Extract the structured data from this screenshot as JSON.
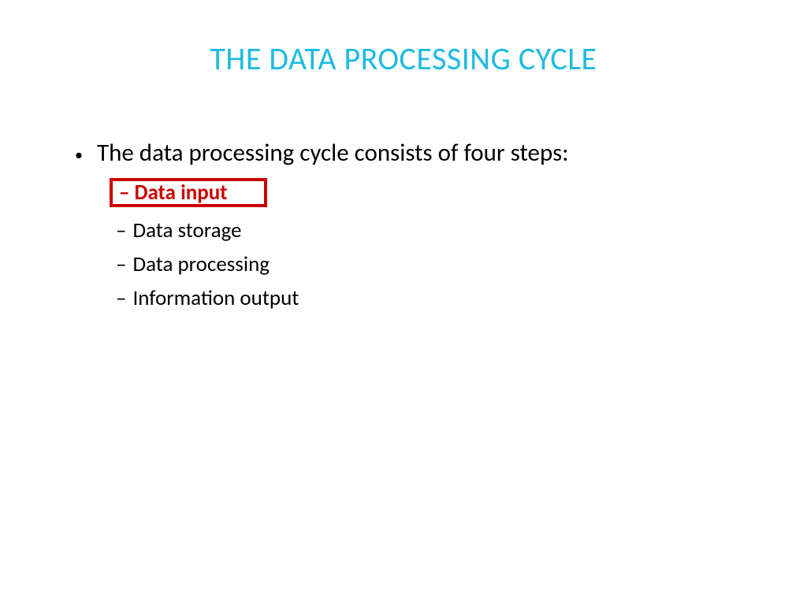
{
  "title": "THE DATA PROCESSING CYCLE",
  "main_bullet": "The data processing cycle consists of four steps:",
  "sub_items": {
    "item0": "Data input",
    "item1": "Data storage",
    "item2": "Data processing",
    "item3": "Information output"
  },
  "markers": {
    "bullet": "•",
    "dash": "–"
  }
}
